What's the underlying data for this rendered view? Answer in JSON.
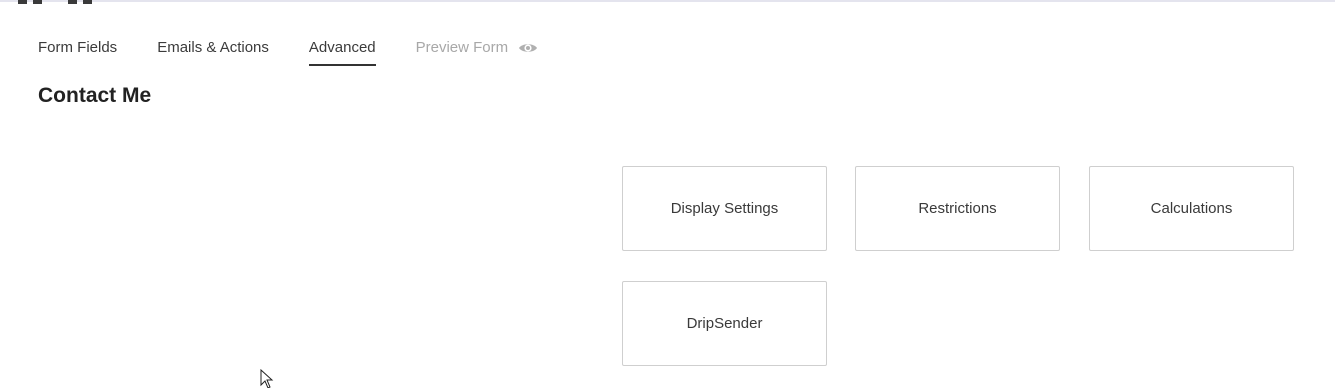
{
  "tabs": [
    {
      "label": "Form Fields",
      "state": "normal"
    },
    {
      "label": "Emails & Actions",
      "state": "normal"
    },
    {
      "label": "Advanced",
      "state": "active"
    },
    {
      "label": "Preview Form",
      "state": "disabled",
      "icon": "eye-icon"
    }
  ],
  "form": {
    "title": "Contact Me"
  },
  "cards": [
    {
      "label": "Display Settings"
    },
    {
      "label": "Restrictions"
    },
    {
      "label": "Calculations"
    },
    {
      "label": "DripSender"
    }
  ],
  "colors": {
    "text": "#333333",
    "muted": "#a8a8a8",
    "border": "#cfcfcf",
    "accent": "#333333"
  }
}
